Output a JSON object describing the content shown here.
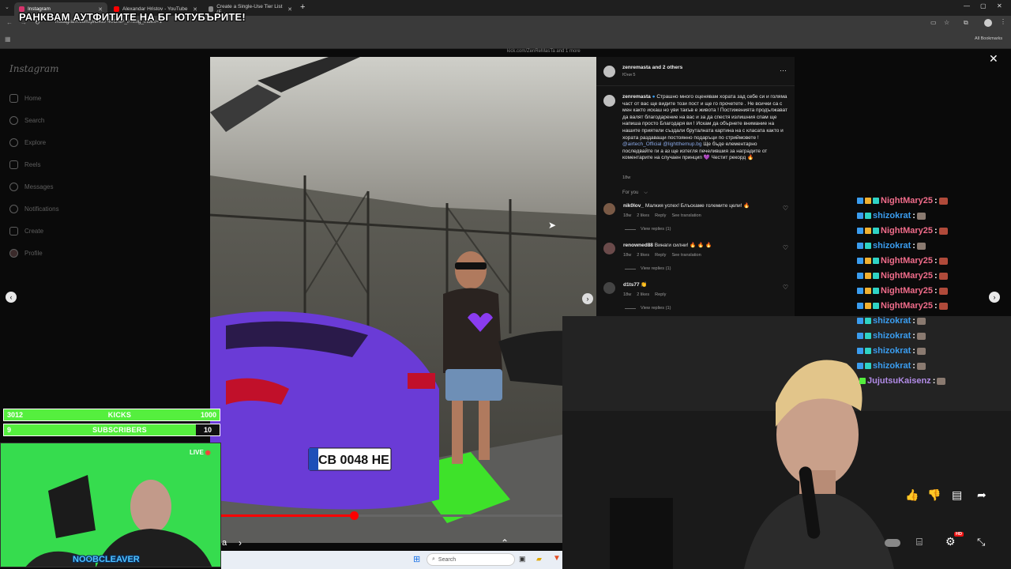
{
  "stream_title": "РАНКВАМ АУТФИТИТЕ НА БГ ЮТУБЪРИТЕ!",
  "browser": {
    "tabs": [
      {
        "label": "Instagram",
        "color": "#d6336c"
      },
      {
        "label": "Alexandar Hristov - YouTube",
        "color": "#ff0000"
      },
      {
        "label": "Create a Single-Use Tier List (F...",
        "color": "#888888"
      }
    ],
    "url": "instagram.com/p/DKkF40ONP_l/?img_index=1",
    "bookmarks_label": "All Bookmarks"
  },
  "instagram": {
    "logo": "Instagram",
    "nav": [
      {
        "label": "Home",
        "icon": "home-icon"
      },
      {
        "label": "Search",
        "icon": "search-icon"
      },
      {
        "label": "Explore",
        "icon": "compass-icon"
      },
      {
        "label": "Reels",
        "icon": "reels-icon"
      },
      {
        "label": "Messages",
        "icon": "messenger-icon"
      },
      {
        "label": "Notifications",
        "icon": "heart-icon"
      },
      {
        "label": "Create",
        "icon": "plus-icon"
      },
      {
        "label": "Profile",
        "icon": "profile-icon"
      }
    ],
    "top_link": "kick.com/ZenReMasTa and 1 more",
    "post": {
      "author_line": "zenremasta and 2 others",
      "date": "Юни 5",
      "caption_user": "zenremasta",
      "caption": "Страшно много оценявам хората зад себе си и голяма част от вас ще видите този пост и ще го прочетете . Не всички са с мен както искаш но уви такъв е живота ! Постиженията продължават да валят благодарение на вас и за да спестя излишния спам ще напиша просто Благодаря ви ! Искам да обърнете внимание на нашите приятели създали бруталната картина на с класата както и хората раздаващи постоянно подаръци по стриймовете !",
      "caption_links": "@airtech_Official @lightthemup.bg",
      "caption_end": "Ще бъде елементарно последвайте ги а аз ще изтегля печелившия за наградите от коментарите на случаен принцип 💜 Честит рекорд 🔥",
      "caption_time": "18w",
      "for_you": "For you",
      "plate": "CB 0048 HE"
    },
    "comments": [
      {
        "user": "nik0lov_",
        "text": "Малкия успех! Блъскаме големите цели! 🔥",
        "time": "18w",
        "likes": "2 likes",
        "reply": "Reply",
        "translate": "See translation",
        "view_replies": "View replies (1)"
      },
      {
        "user": "renowned88",
        "text": "Винаги силни! 🔥 🔥 🔥",
        "time": "18w",
        "likes": "2 likes",
        "reply": "Reply",
        "translate": "See translation",
        "view_replies": "View replies (1)"
      },
      {
        "user": "d1ts77",
        "text": "👏",
        "time": "18w",
        "likes": "2 likes",
        "reply": "Reply",
        "translate": "",
        "view_replies": "View replies (1)"
      }
    ]
  },
  "chat": [
    {
      "name": "NightMary25",
      "kind": "nm"
    },
    {
      "name": "shizokrat",
      "kind": "sk"
    },
    {
      "name": "NightMary25",
      "kind": "nm"
    },
    {
      "name": "shizokrat",
      "kind": "sk"
    },
    {
      "name": "NightMary25",
      "kind": "nm"
    },
    {
      "name": "NightMary25",
      "kind": "nm"
    },
    {
      "name": "NightMary25",
      "kind": "nm"
    },
    {
      "name": "NightMary25",
      "kind": "nm"
    },
    {
      "name": "shizokrat",
      "kind": "sk"
    },
    {
      "name": "shizokrat",
      "kind": "sk"
    },
    {
      "name": "shizokrat",
      "kind": "sk"
    },
    {
      "name": "shizokrat",
      "kind": "sk"
    },
    {
      "name": "JujutsuKaisenz",
      "kind": "jj"
    }
  ],
  "counters": [
    {
      "left": "3012",
      "label": "KICKS",
      "right": "1000"
    },
    {
      "left": "9",
      "label": "SUBSCRIBERS",
      "right": "10"
    }
  ],
  "webcam": {
    "live": "LIVE",
    "name": "NOOBCLEAVER"
  },
  "video": {
    "progress": 0.39,
    "hd_badge": "HD"
  },
  "taskbar": {
    "search": "Search"
  },
  "sidebar_letter": "a",
  "colors": {
    "accent": "#55ef3e",
    "chat_pink": "#f06c8a",
    "chat_blue": "#3a9df0",
    "chat_purple": "#b18be6",
    "progress": "#ff0000"
  }
}
